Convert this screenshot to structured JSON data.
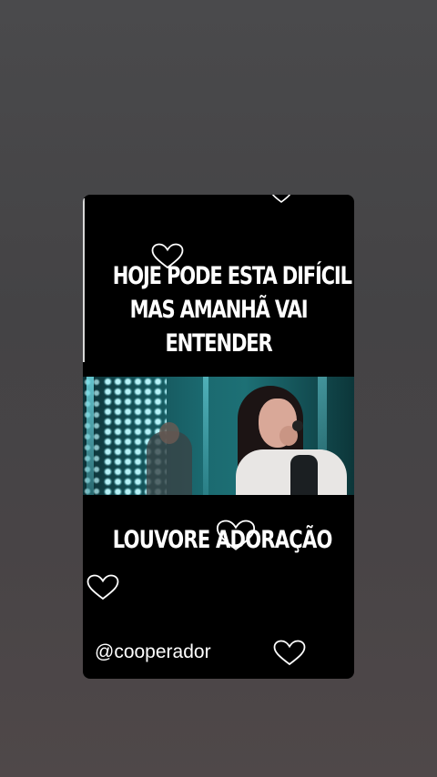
{
  "story": {
    "headline_lines": [
      "HOJE PODE ESTA DIFÍCIL",
      "MAS AMANHÃ VAI",
      "ENTENDER"
    ],
    "subheadline": "LOUVORE ADORAÇÃO",
    "handle": "@cooperador"
  },
  "video": {
    "description_icon": "singer-performing-video"
  },
  "decorations": {
    "icon": "heart-outline-icon",
    "color": "#ffffff"
  },
  "colors": {
    "card_background": "#000000",
    "page_background": "#474647",
    "text": "#ffffff"
  }
}
